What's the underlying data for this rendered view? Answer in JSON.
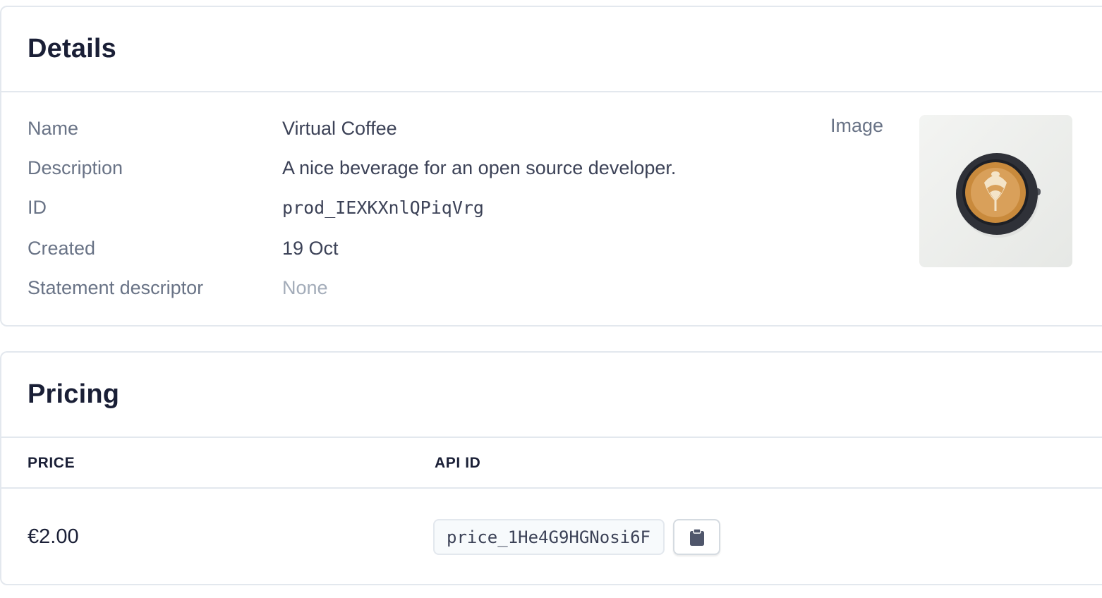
{
  "details": {
    "title": "Details",
    "rows": [
      {
        "label": "Name",
        "value": "Virtual Coffee"
      },
      {
        "label": "Description",
        "value": "A nice beverage for an open source developer."
      },
      {
        "label": "ID",
        "value": "prod_IEXKXnlQPiqVrg"
      },
      {
        "label": "Created",
        "value": "19 Oct"
      },
      {
        "label": "Statement descriptor",
        "value": "None"
      }
    ],
    "image_label": "Image",
    "image_icon": "coffee-cup-latte-art-photo"
  },
  "pricing": {
    "title": "Pricing",
    "columns": {
      "price": "PRICE",
      "api_id": "API ID"
    },
    "rows": [
      {
        "price": "€2.00",
        "api_id": "price_1He4G9HGNosi6F"
      }
    ],
    "copy_icon": "clipboard-icon"
  },
  "colors": {
    "border": "#e3e8ee",
    "label": "#697386",
    "text": "#3c4257",
    "heading": "#1a1f36",
    "muted": "#a3acb9"
  }
}
